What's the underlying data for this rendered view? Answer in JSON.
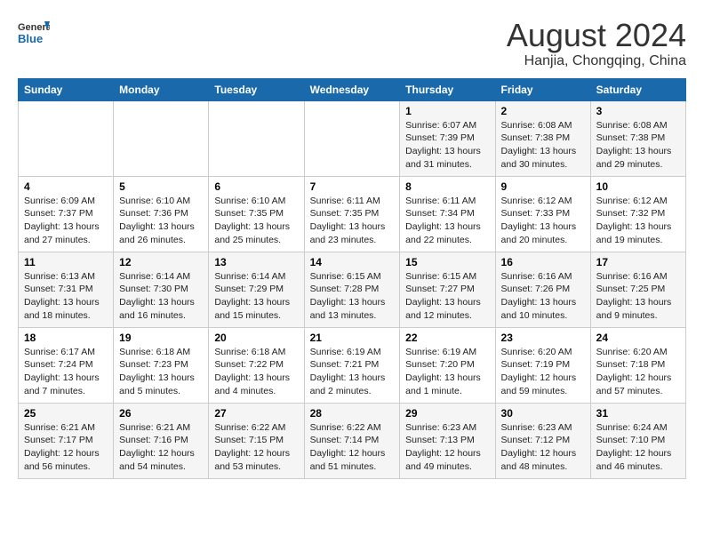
{
  "header": {
    "logo_line1": "General",
    "logo_line2": "Blue",
    "main_title": "August 2024",
    "subtitle": "Hanjia, Chongqing, China"
  },
  "calendar": {
    "weekdays": [
      "Sunday",
      "Monday",
      "Tuesday",
      "Wednesday",
      "Thursday",
      "Friday",
      "Saturday"
    ],
    "weeks": [
      [
        {
          "day": "",
          "info": ""
        },
        {
          "day": "",
          "info": ""
        },
        {
          "day": "",
          "info": ""
        },
        {
          "day": "",
          "info": ""
        },
        {
          "day": "1",
          "info": "Sunrise: 6:07 AM\nSunset: 7:39 PM\nDaylight: 13 hours\nand 31 minutes."
        },
        {
          "day": "2",
          "info": "Sunrise: 6:08 AM\nSunset: 7:38 PM\nDaylight: 13 hours\nand 30 minutes."
        },
        {
          "day": "3",
          "info": "Sunrise: 6:08 AM\nSunset: 7:38 PM\nDaylight: 13 hours\nand 29 minutes."
        }
      ],
      [
        {
          "day": "4",
          "info": "Sunrise: 6:09 AM\nSunset: 7:37 PM\nDaylight: 13 hours\nand 27 minutes."
        },
        {
          "day": "5",
          "info": "Sunrise: 6:10 AM\nSunset: 7:36 PM\nDaylight: 13 hours\nand 26 minutes."
        },
        {
          "day": "6",
          "info": "Sunrise: 6:10 AM\nSunset: 7:35 PM\nDaylight: 13 hours\nand 25 minutes."
        },
        {
          "day": "7",
          "info": "Sunrise: 6:11 AM\nSunset: 7:35 PM\nDaylight: 13 hours\nand 23 minutes."
        },
        {
          "day": "8",
          "info": "Sunrise: 6:11 AM\nSunset: 7:34 PM\nDaylight: 13 hours\nand 22 minutes."
        },
        {
          "day": "9",
          "info": "Sunrise: 6:12 AM\nSunset: 7:33 PM\nDaylight: 13 hours\nand 20 minutes."
        },
        {
          "day": "10",
          "info": "Sunrise: 6:12 AM\nSunset: 7:32 PM\nDaylight: 13 hours\nand 19 minutes."
        }
      ],
      [
        {
          "day": "11",
          "info": "Sunrise: 6:13 AM\nSunset: 7:31 PM\nDaylight: 13 hours\nand 18 minutes."
        },
        {
          "day": "12",
          "info": "Sunrise: 6:14 AM\nSunset: 7:30 PM\nDaylight: 13 hours\nand 16 minutes."
        },
        {
          "day": "13",
          "info": "Sunrise: 6:14 AM\nSunset: 7:29 PM\nDaylight: 13 hours\nand 15 minutes."
        },
        {
          "day": "14",
          "info": "Sunrise: 6:15 AM\nSunset: 7:28 PM\nDaylight: 13 hours\nand 13 minutes."
        },
        {
          "day": "15",
          "info": "Sunrise: 6:15 AM\nSunset: 7:27 PM\nDaylight: 13 hours\nand 12 minutes."
        },
        {
          "day": "16",
          "info": "Sunrise: 6:16 AM\nSunset: 7:26 PM\nDaylight: 13 hours\nand 10 minutes."
        },
        {
          "day": "17",
          "info": "Sunrise: 6:16 AM\nSunset: 7:25 PM\nDaylight: 13 hours\nand 9 minutes."
        }
      ],
      [
        {
          "day": "18",
          "info": "Sunrise: 6:17 AM\nSunset: 7:24 PM\nDaylight: 13 hours\nand 7 minutes."
        },
        {
          "day": "19",
          "info": "Sunrise: 6:18 AM\nSunset: 7:23 PM\nDaylight: 13 hours\nand 5 minutes."
        },
        {
          "day": "20",
          "info": "Sunrise: 6:18 AM\nSunset: 7:22 PM\nDaylight: 13 hours\nand 4 minutes."
        },
        {
          "day": "21",
          "info": "Sunrise: 6:19 AM\nSunset: 7:21 PM\nDaylight: 13 hours\nand 2 minutes."
        },
        {
          "day": "22",
          "info": "Sunrise: 6:19 AM\nSunset: 7:20 PM\nDaylight: 13 hours\nand 1 minute."
        },
        {
          "day": "23",
          "info": "Sunrise: 6:20 AM\nSunset: 7:19 PM\nDaylight: 12 hours\nand 59 minutes."
        },
        {
          "day": "24",
          "info": "Sunrise: 6:20 AM\nSunset: 7:18 PM\nDaylight: 12 hours\nand 57 minutes."
        }
      ],
      [
        {
          "day": "25",
          "info": "Sunrise: 6:21 AM\nSunset: 7:17 PM\nDaylight: 12 hours\nand 56 minutes."
        },
        {
          "day": "26",
          "info": "Sunrise: 6:21 AM\nSunset: 7:16 PM\nDaylight: 12 hours\nand 54 minutes."
        },
        {
          "day": "27",
          "info": "Sunrise: 6:22 AM\nSunset: 7:15 PM\nDaylight: 12 hours\nand 53 minutes."
        },
        {
          "day": "28",
          "info": "Sunrise: 6:22 AM\nSunset: 7:14 PM\nDaylight: 12 hours\nand 51 minutes."
        },
        {
          "day": "29",
          "info": "Sunrise: 6:23 AM\nSunset: 7:13 PM\nDaylight: 12 hours\nand 49 minutes."
        },
        {
          "day": "30",
          "info": "Sunrise: 6:23 AM\nSunset: 7:12 PM\nDaylight: 12 hours\nand 48 minutes."
        },
        {
          "day": "31",
          "info": "Sunrise: 6:24 AM\nSunset: 7:10 PM\nDaylight: 12 hours\nand 46 minutes."
        }
      ]
    ]
  }
}
